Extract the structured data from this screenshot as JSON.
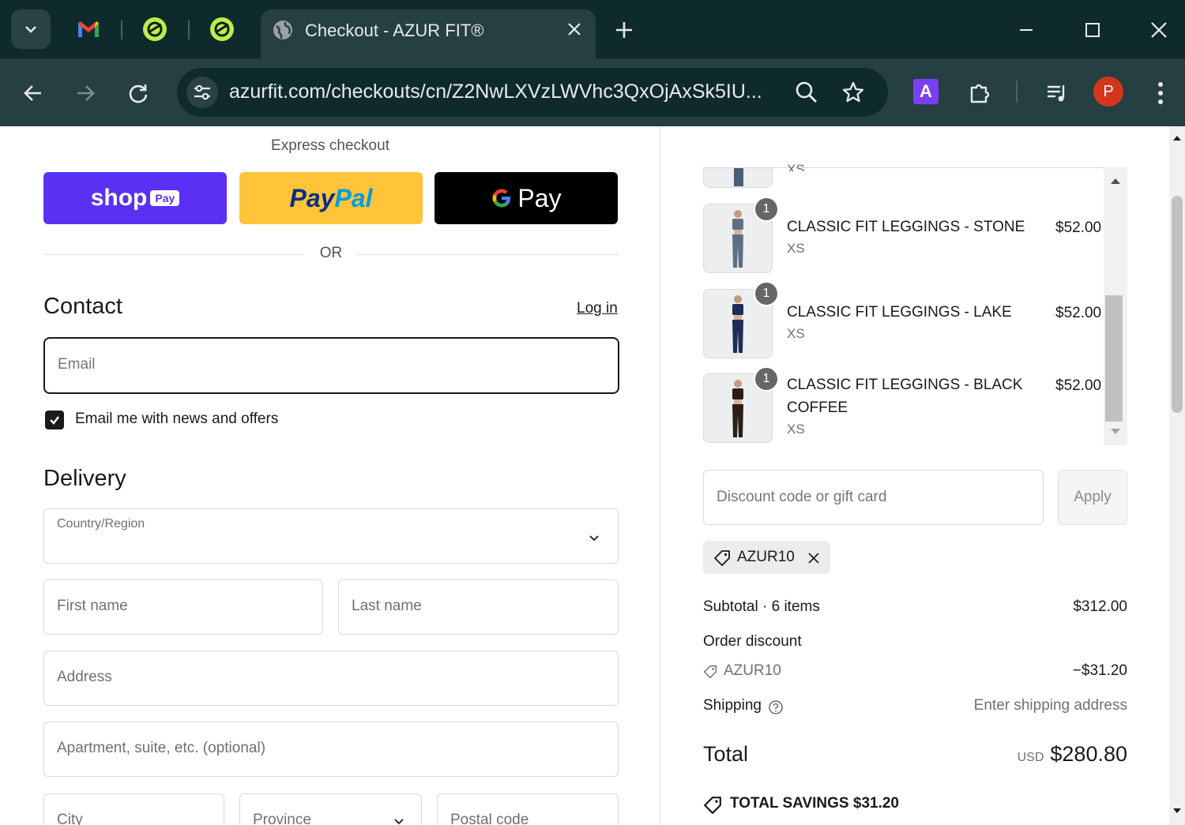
{
  "browser": {
    "active_tab_title": "Checkout - AZUR FIT®",
    "url": "azurfit.com/checkouts/cn/Z2NwLXVzLWVhc3QxOjAxSk5IU...",
    "extension_letter": "A",
    "profile_initial": "P"
  },
  "express": {
    "title": "Express checkout",
    "shop_label": "shop",
    "shop_badge": "Pay",
    "paypal_label": "PayPal",
    "gpay_label": "Pay",
    "or_label": "OR"
  },
  "contact": {
    "heading": "Contact",
    "login_link": "Log in",
    "email_placeholder": "Email",
    "news_checkbox_label": "Email me with news and offers",
    "news_checked": true
  },
  "delivery": {
    "heading": "Delivery",
    "country_label": "Country/Region",
    "first_name_placeholder": "First name",
    "last_name_placeholder": "Last name",
    "address_placeholder": "Address",
    "apartment_placeholder": "Apartment, suite, etc. (optional)",
    "city_placeholder": "City",
    "province_placeholder": "Province",
    "postal_placeholder": "Postal code"
  },
  "order": {
    "partial_item_variant": "XS",
    "items": [
      {
        "qty": "1",
        "name": "CLASSIC FIT LEGGINGS - STONE",
        "variant": "XS",
        "price": "$52.00",
        "color": "#5c6f86"
      },
      {
        "qty": "1",
        "name": "CLASSIC FIT LEGGINGS - LAKE",
        "variant": "XS",
        "price": "$52.00",
        "color": "#1f2c55"
      },
      {
        "qty": "1",
        "name_line1": "CLASSIC FIT LEGGINGS - BLACK",
        "name_line2": "COFFEE",
        "variant": "XS",
        "price": "$52.00",
        "color": "#2b1d18"
      }
    ],
    "discount_placeholder": "Discount code or gift card",
    "apply_label": "Apply",
    "applied_code": "AZUR10",
    "subtotal_label": "Subtotal · 6 items",
    "subtotal_value": "$312.00",
    "order_discount_label": "Order discount",
    "discount_code": "AZUR10",
    "discount_value": "−$31.20",
    "shipping_label": "Shipping",
    "shipping_value": "Enter shipping address",
    "total_label": "Total",
    "total_currency": "USD",
    "total_value": "$280.80",
    "savings_label": "TOTAL SAVINGS  $31.20"
  }
}
